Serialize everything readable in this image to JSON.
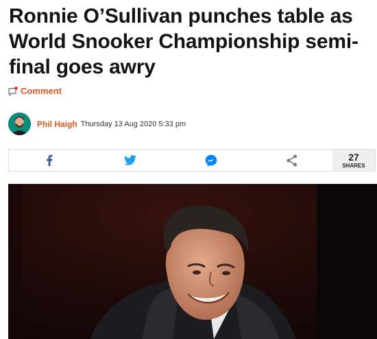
{
  "article": {
    "headline": "Ronnie O’Sullivan punches table as World Snooker Championship semi-final goes awry",
    "comment_label": "Comment",
    "author": "Phil Haigh",
    "date": "Thursday 13 Aug 2020 5:33 pm"
  },
  "share": {
    "buttons": [
      {
        "name": "facebook",
        "icon": "facebook-icon",
        "color": "#3b5998"
      },
      {
        "name": "twitter",
        "icon": "twitter-icon",
        "color": "#1da1f2"
      },
      {
        "name": "messenger",
        "icon": "messenger-icon",
        "color": "#0084ff"
      },
      {
        "name": "share",
        "icon": "share-icon",
        "color": "#777777"
      }
    ],
    "count": "27",
    "count_label": "SHARES"
  },
  "colors": {
    "accent": "#d8581f",
    "headline": "#141414"
  }
}
